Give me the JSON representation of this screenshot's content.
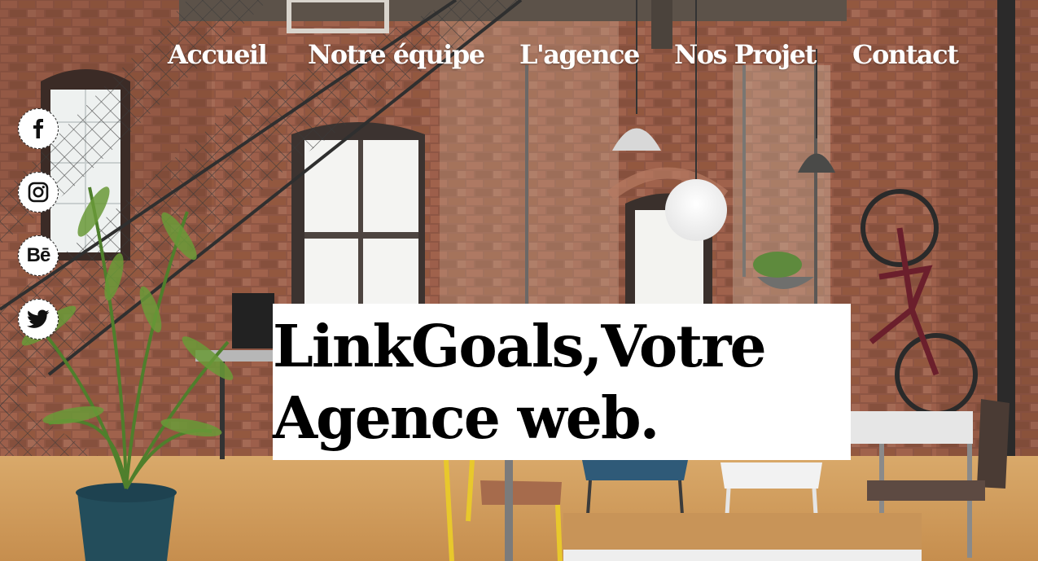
{
  "nav": {
    "items": [
      {
        "label": "Accueil"
      },
      {
        "label": "Notre équipe"
      },
      {
        "label": "L'agence"
      },
      {
        "label": "Nos Projet"
      },
      {
        "label": "Contact"
      }
    ]
  },
  "social": {
    "items": [
      {
        "icon": "facebook-icon"
      },
      {
        "icon": "instagram-icon",
        "label": ""
      },
      {
        "icon": "behance-icon",
        "label": "Bē"
      },
      {
        "icon": "twitter-icon"
      }
    ]
  },
  "hero": {
    "line1": "LinkGoals,Votre",
    "line2": "Agence web."
  },
  "colors": {
    "brick": "#8a5a44",
    "nav_text": "#ffffff",
    "headline_bg": "#ffffff",
    "headline_text": "#000000"
  }
}
